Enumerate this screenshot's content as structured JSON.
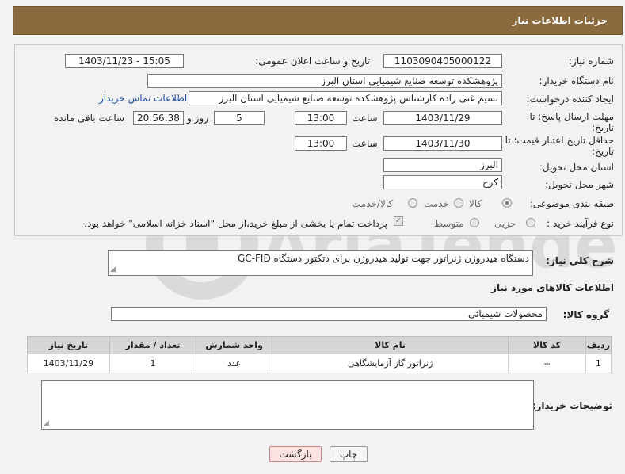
{
  "header": {
    "title": "جزئیات اطلاعات نیاز"
  },
  "form": {
    "need_number_label": "شماره نیاز:",
    "need_number": "1103090405000122",
    "announce_label": "تاریخ و ساعت اعلان عمومی:",
    "announce_value": "1403/11/23 - 15:05",
    "buyer_org_label": "نام دستگاه خریدار:",
    "buyer_org": "پژوهشکده توسعه صنایع شیمیایی استان البرز",
    "creator_label": "ایجاد کننده درخواست:",
    "creator": "نسیم غنی زاده کارشناس پژوهشکده توسعه صنایع شیمیایی استان البرز",
    "contact_link": "اطلاعات تماس خریدار",
    "deadline_label_1": "مهلت ارسال پاسخ: تا",
    "deadline_label_2": "تاریخ:",
    "deadline_date": "1403/11/29",
    "time_label": "ساعت",
    "deadline_time": "13:00",
    "days_value": "5",
    "days_label": "روز و",
    "remaining_time": "20:56:38",
    "remaining_label": "ساعت باقی مانده",
    "validity_label_1": "حداقل تاریخ اعتبار قیمت: تا",
    "validity_label_2": "تاریخ:",
    "validity_date": "1403/11/30",
    "validity_time": "13:00",
    "province_label": "استان محل تحویل:",
    "province": "البرز",
    "city_label": "شهر محل تحویل:",
    "city": "کرج",
    "category_label": "طبقه بندی موضوعی:",
    "category_options": [
      "کالا",
      "خدمت",
      "کالا/خدمت"
    ],
    "process_label": "نوع فرآیند خرید :",
    "process_options": [
      "جزیی",
      "متوسط"
    ],
    "payment_note": "پرداخت تمام یا بخشی از مبلغ خرید،از محل \"اسناد خزانه اسلامی\" خواهد بود."
  },
  "description": {
    "label": "شرح کلی نیاز:",
    "text": "دستگاه هیدروژن ژنراتور جهت تولید هیدروژن برای دتکتور دستگاه GC-FID"
  },
  "goods": {
    "section_title": "اطلاعات کالاهای مورد نیاز",
    "group_label": "گروه کالا:",
    "group_value": "محصولات شیمیائی",
    "columns": [
      "ردیف",
      "کد کالا",
      "نام کالا",
      "واحد شمارش",
      "تعداد / مقدار",
      "تاریخ نیاز"
    ],
    "rows": [
      [
        "1",
        "--",
        "ژنراتور گاز آزمایشگاهی",
        "عدد",
        "1",
        "1403/11/29"
      ]
    ]
  },
  "buyer_notes": {
    "label": "توضیحات خریدار:",
    "text": ""
  },
  "buttons": {
    "print": "چاپ",
    "back": "بازگشت"
  }
}
